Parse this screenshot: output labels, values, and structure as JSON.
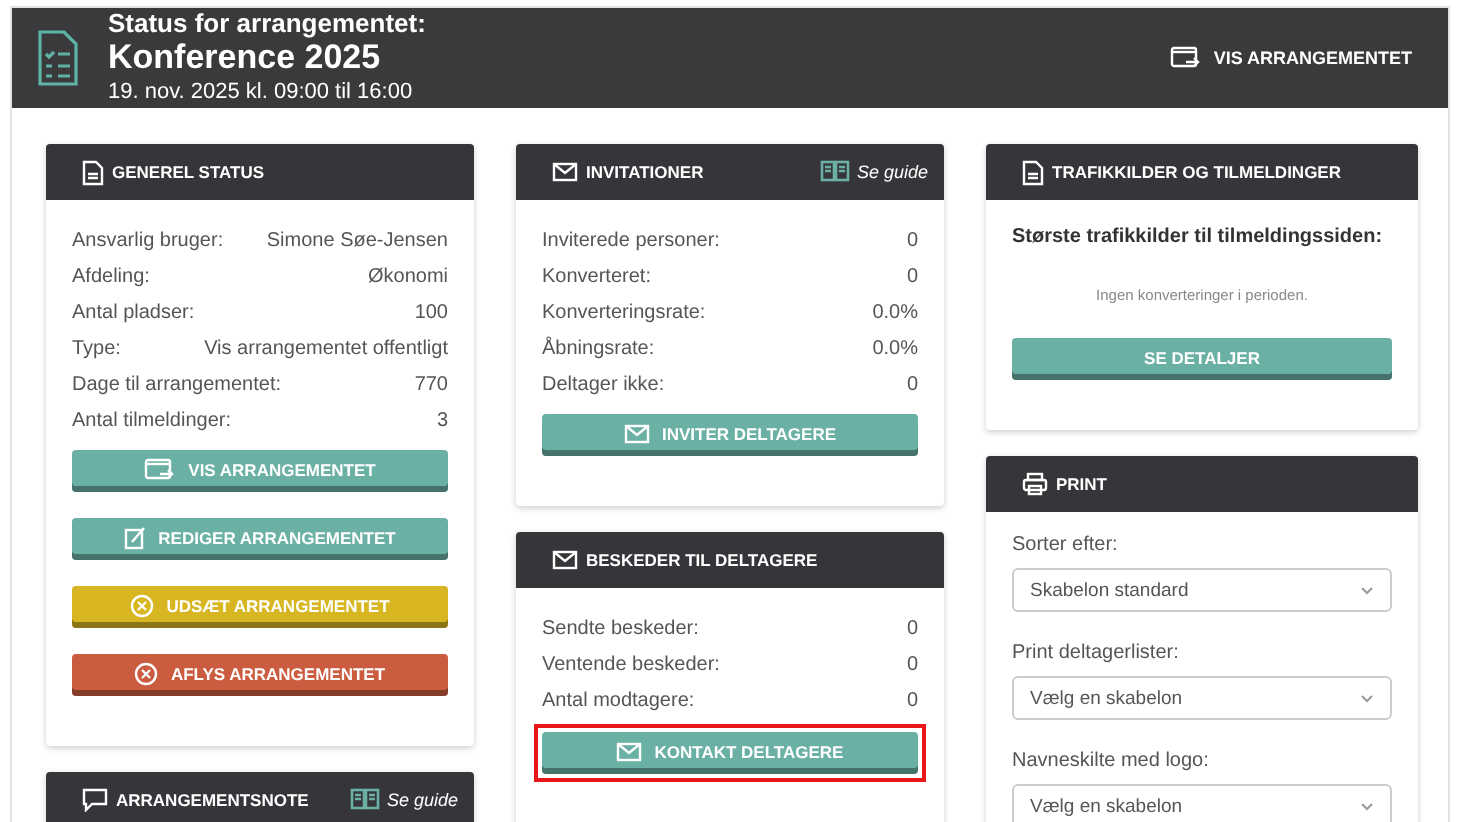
{
  "header": {
    "subtitle": "Status for arrangementet:",
    "title": "Konference 2025",
    "date": "19. nov. 2025 kl. 09:00 til 16:00",
    "action": "VIS ARRANGEMENTET"
  },
  "columns": [
    {
      "panels": [
        {
          "kind": "stats",
          "title": "GENEREL STATUS",
          "rows": [
            {
              "label": "Ansvarlig bruger:",
              "value": "Simone Søe-Jensen"
            },
            {
              "label": "Afdeling:",
              "value": "Økonomi"
            },
            {
              "label": "Antal pladser:",
              "value": "100"
            },
            {
              "label": "Type:",
              "value": "Vis arrangementet offentligt"
            },
            {
              "label": "Dage til arrangementet:",
              "value": "770"
            },
            {
              "label": "Antal tilmeldinger:",
              "value": "3"
            }
          ],
          "buttons": [
            {
              "label": "VIS ARRANGEMENTET",
              "color": "#6ab0a5",
              "highlighted": false
            },
            {
              "label": "REDIGER ARRANGEMENTET",
              "color": "#6ab0a5",
              "highlighted": false
            },
            {
              "label": "UDSÆT ARRANGEMENTET",
              "color": "#d8b622",
              "highlighted": false
            },
            {
              "label": "AFLYS ARRANGEMENTET",
              "color": "#cb5c3f",
              "highlighted": false
            }
          ]
        },
        {
          "kind": "header_only",
          "title": "ARRANGEMENTSNOTE",
          "guide": "Se guide"
        }
      ]
    },
    {
      "panels": [
        {
          "kind": "stats",
          "title": "INVITATIONER",
          "guide": "Se guide",
          "rows": [
            {
              "label": "Inviterede personer:",
              "value": "0"
            },
            {
              "label": "Konverteret:",
              "value": "0"
            },
            {
              "label": "Konverteringsrate:",
              "value": "0.0%"
            },
            {
              "label": "Åbningsrate:",
              "value": "0.0%"
            },
            {
              "label": "Deltager ikke:",
              "value": "0"
            }
          ],
          "buttons": [
            {
              "label": "INVITER DELTAGERE",
              "color": "#6ab0a5",
              "highlighted": false
            }
          ]
        },
        {
          "kind": "stats",
          "title": "BESKEDER TIL DELTAGERE",
          "rows": [
            {
              "label": "Sendte beskeder:",
              "value": "0"
            },
            {
              "label": "Ventende beskeder:",
              "value": "0"
            },
            {
              "label": "Antal modtagere:",
              "value": "0"
            }
          ],
          "buttons": [
            {
              "label": "KONTAKT DELTAGERE",
              "color": "#6ab0a5",
              "highlighted": true
            }
          ]
        }
      ]
    },
    {
      "panels": [
        {
          "kind": "traffic",
          "title": "TRAFIKKILDER OG TILMELDINGER",
          "heading": "Største trafikkilder til tilmeldingssiden:",
          "empty": "Ingen konverteringer i perioden.",
          "buttons": [
            {
              "label": "SE DETALJER",
              "color": "#6ab0a5",
              "highlighted": false
            }
          ]
        },
        {
          "kind": "print",
          "title": "PRINT",
          "fields": [
            {
              "label": "Sorter efter:",
              "value": "Skabelon standard"
            },
            {
              "label": "Print deltagerlister:",
              "value": "Vælg en skabelon"
            },
            {
              "label": "Navneskilte med logo:",
              "value": "Vælg en skabelon"
            }
          ]
        }
      ]
    }
  ]
}
